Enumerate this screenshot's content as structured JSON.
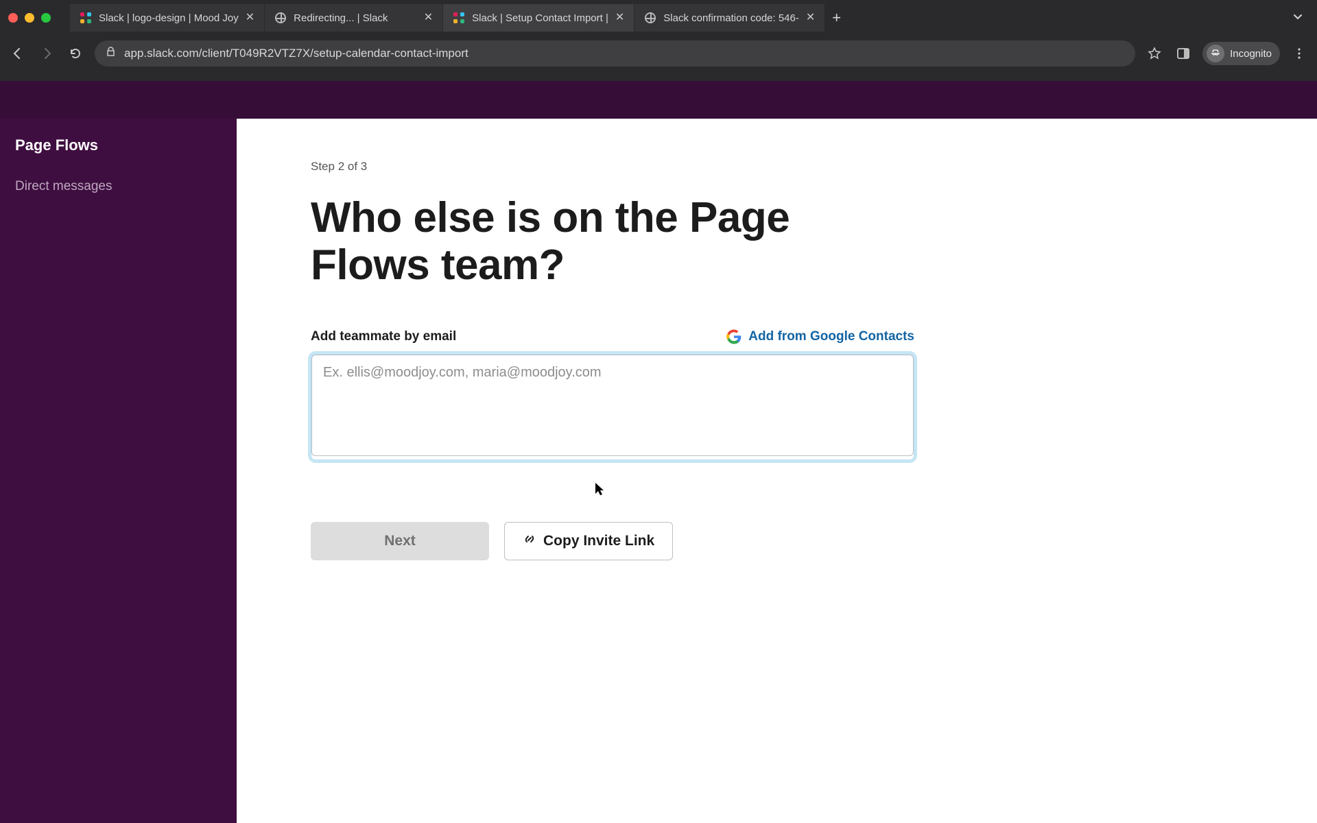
{
  "browser": {
    "tabs": [
      {
        "title": "Slack | logo-design | Mood Joy",
        "type": "slack"
      },
      {
        "title": "Redirecting... | Slack",
        "type": "globe"
      },
      {
        "title": "Slack | Setup Contact Import |",
        "type": "slack",
        "active": true
      },
      {
        "title": "Slack confirmation code: 546-",
        "type": "globe"
      }
    ],
    "url": "app.slack.com/client/T049R2VTZ7X/setup-calendar-contact-import",
    "incognito_label": "Incognito"
  },
  "sidebar": {
    "workspace": "Page Flows",
    "items": [
      {
        "label": "Direct messages"
      }
    ]
  },
  "setup": {
    "step_label": "Step 2 of 3",
    "heading": "Who else is on the Page Flows team?",
    "email_label": "Add teammate by email",
    "google_contacts_label": "Add from Google Contacts",
    "email_placeholder": "Ex. ellis@moodjoy.com, maria@moodjoy.com",
    "email_value": "",
    "next_label": "Next",
    "copy_link_label": "Copy Invite Link"
  }
}
